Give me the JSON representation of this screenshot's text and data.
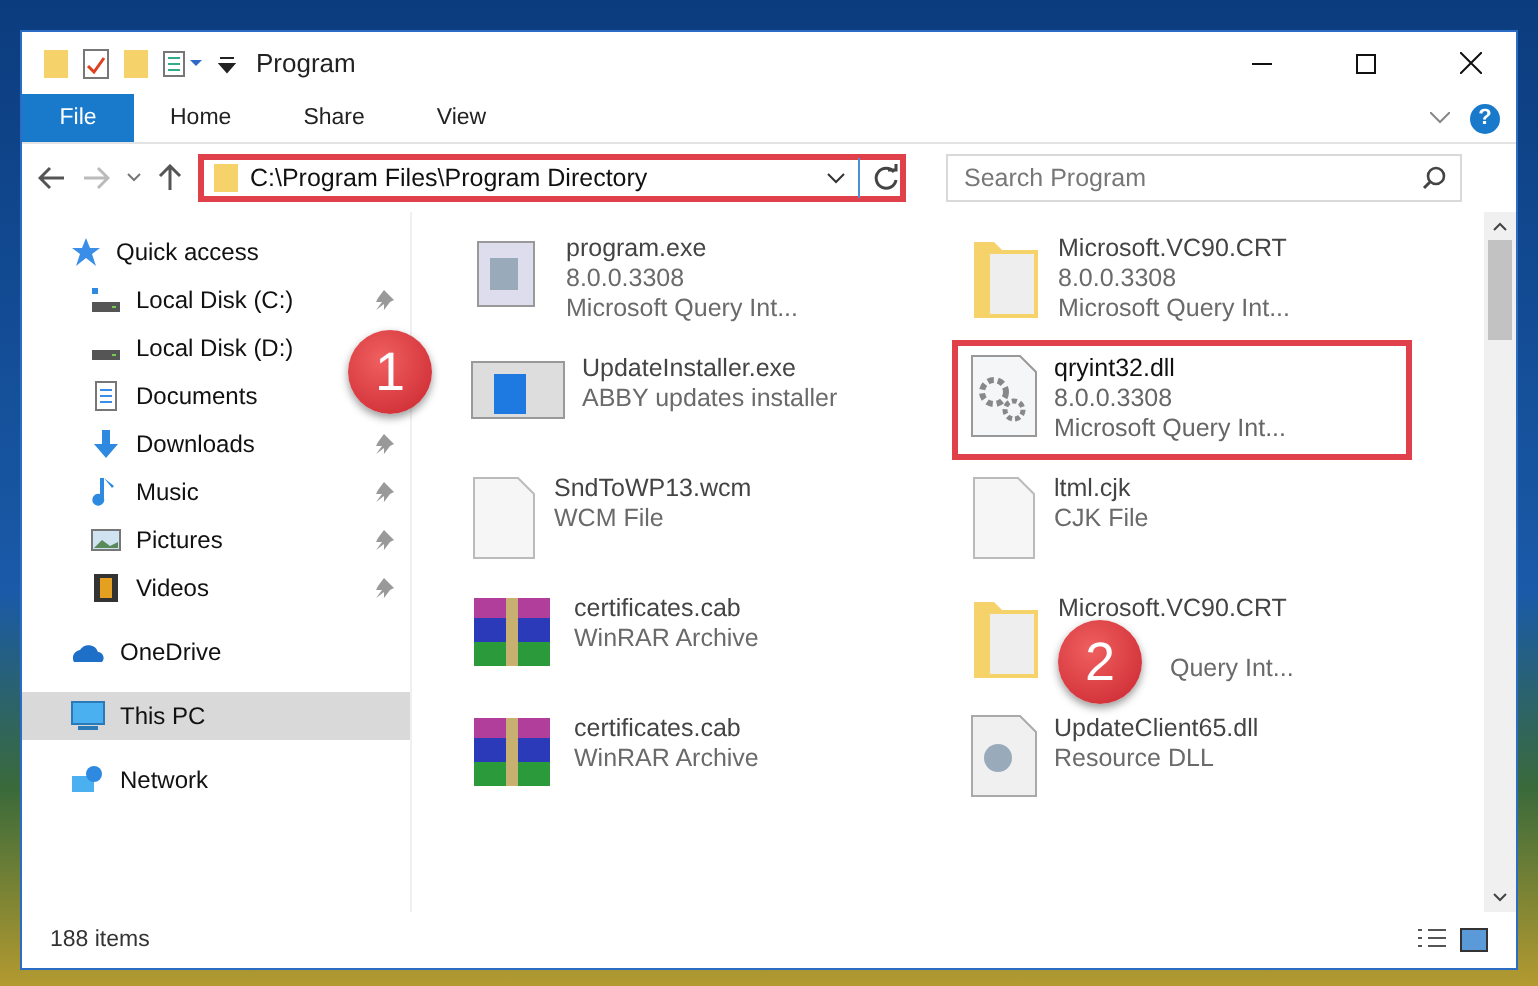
{
  "window": {
    "title": "Program"
  },
  "ribbon": {
    "tabs": [
      {
        "label": "File",
        "kind": "file"
      },
      {
        "label": "Home",
        "kind": "tab"
      },
      {
        "label": "Share",
        "kind": "tab"
      },
      {
        "label": "View",
        "kind": "tab"
      }
    ],
    "help_label": "?"
  },
  "address_bar": {
    "path": "C:\\Program Files\\Program Directory",
    "highlighted": true
  },
  "search": {
    "placeholder": "Search Program"
  },
  "sidebar": {
    "groups": [
      {
        "label": "Quick access",
        "kind": "star",
        "selected": false,
        "children": [
          {
            "label": "Local Disk (C:)",
            "kind": "system-disk",
            "pinned": true,
            "selected": false
          },
          {
            "label": "Local Disk (D:)",
            "kind": "disk",
            "pinned": false,
            "selected": false
          },
          {
            "label": "Documents",
            "kind": "documents",
            "pinned": false,
            "selected": false
          },
          {
            "label": "Downloads",
            "kind": "downloads",
            "pinned": true,
            "selected": false
          },
          {
            "label": "Music",
            "kind": "music",
            "pinned": true,
            "selected": false
          },
          {
            "label": "Pictures",
            "kind": "pictures",
            "pinned": true,
            "selected": false
          },
          {
            "label": "Videos",
            "kind": "videos",
            "pinned": true,
            "selected": false
          }
        ]
      },
      {
        "label": "OneDrive",
        "kind": "cloud",
        "selected": false
      },
      {
        "label": "This PC",
        "kind": "pc",
        "selected": true
      },
      {
        "label": "Network",
        "kind": "network",
        "selected": false
      }
    ]
  },
  "files": [
    {
      "name": "program.exe",
      "details": [
        "8.0.0.3308",
        "Microsoft Query Int..."
      ],
      "kind": "exe",
      "highlighted": false
    },
    {
      "name": "Microsoft.VC90.CRT",
      "details": [
        "8.0.0.3308",
        "Microsoft Query Int..."
      ],
      "kind": "folder",
      "highlighted": false
    },
    {
      "name": "UpdateInstaller.exe",
      "details": [
        "ABBY updates installer"
      ],
      "kind": "installer",
      "highlighted": false
    },
    {
      "name": "qryint32.dll",
      "details": [
        "8.0.0.3308",
        "Microsoft Query Int..."
      ],
      "kind": "dll",
      "highlighted": true
    },
    {
      "name": "SndToWP13.wcm",
      "details": [
        "WCM File"
      ],
      "kind": "file",
      "highlighted": false
    },
    {
      "name": "ltml.cjk",
      "details": [
        "CJK File"
      ],
      "kind": "file",
      "highlighted": false
    },
    {
      "name": "certificates.cab",
      "details": [
        "WinRAR Archive"
      ],
      "kind": "archive",
      "highlighted": false
    },
    {
      "name": "Microsoft.VC90.CRT",
      "details": [
        "Query Int..."
      ],
      "kind": "folder",
      "highlighted": false,
      "covered": true
    },
    {
      "name": "certificates.cab",
      "details": [
        "WinRAR Archive"
      ],
      "kind": "archive",
      "highlighted": false
    },
    {
      "name": "UpdateClient65.dll",
      "details": [
        "Resource DLL"
      ],
      "kind": "dll-resource",
      "highlighted": false
    }
  ],
  "status_bar": {
    "count": "188 items"
  },
  "annotations": [
    {
      "label": "1"
    },
    {
      "label": "2"
    }
  ]
}
